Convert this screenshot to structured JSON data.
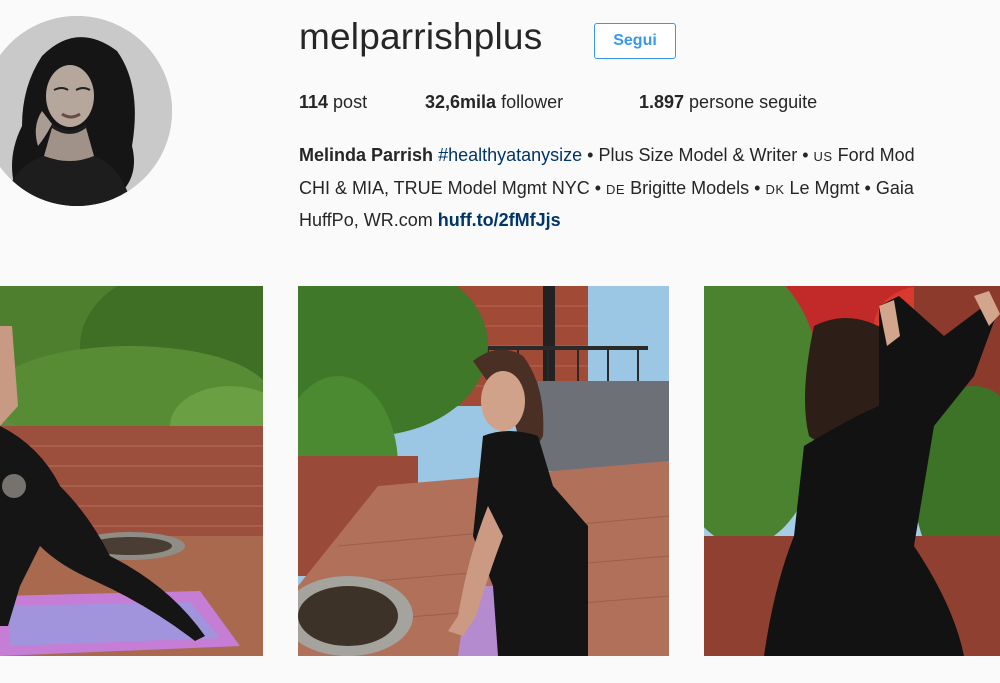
{
  "profile": {
    "username": "melparrishplus",
    "follow_label": "Segui",
    "avatar_alt": "profile-photo"
  },
  "stats": {
    "posts_count": "114",
    "posts_label": "post",
    "followers_count": "32,6mila",
    "followers_label": "follower",
    "following_count": "1.897",
    "following_label": "persone seguite"
  },
  "bio": {
    "name": "Melinda Parrish",
    "hashtag": "#healthyatanysize",
    "line1_rest": " • Plus Size Model & Writer • ",
    "flag_us": "US",
    "line1_tail": " Ford Mod",
    "line2_a": "CHI & MIA, TRUE Model Mgmt NYC • ",
    "flag_de": "DE",
    "line2_b": " Brigitte Models • ",
    "flag_dk": "DK",
    "line2_c": " Le Mgmt • Gaia",
    "line3_a": "HuffPo, WR.com ",
    "link": "huff.to/2fMfJjs"
  },
  "posts": [
    {
      "name": "post-yoga-triangle"
    },
    {
      "name": "post-yoga-warrior"
    },
    {
      "name": "post-back-stretch"
    }
  ]
}
